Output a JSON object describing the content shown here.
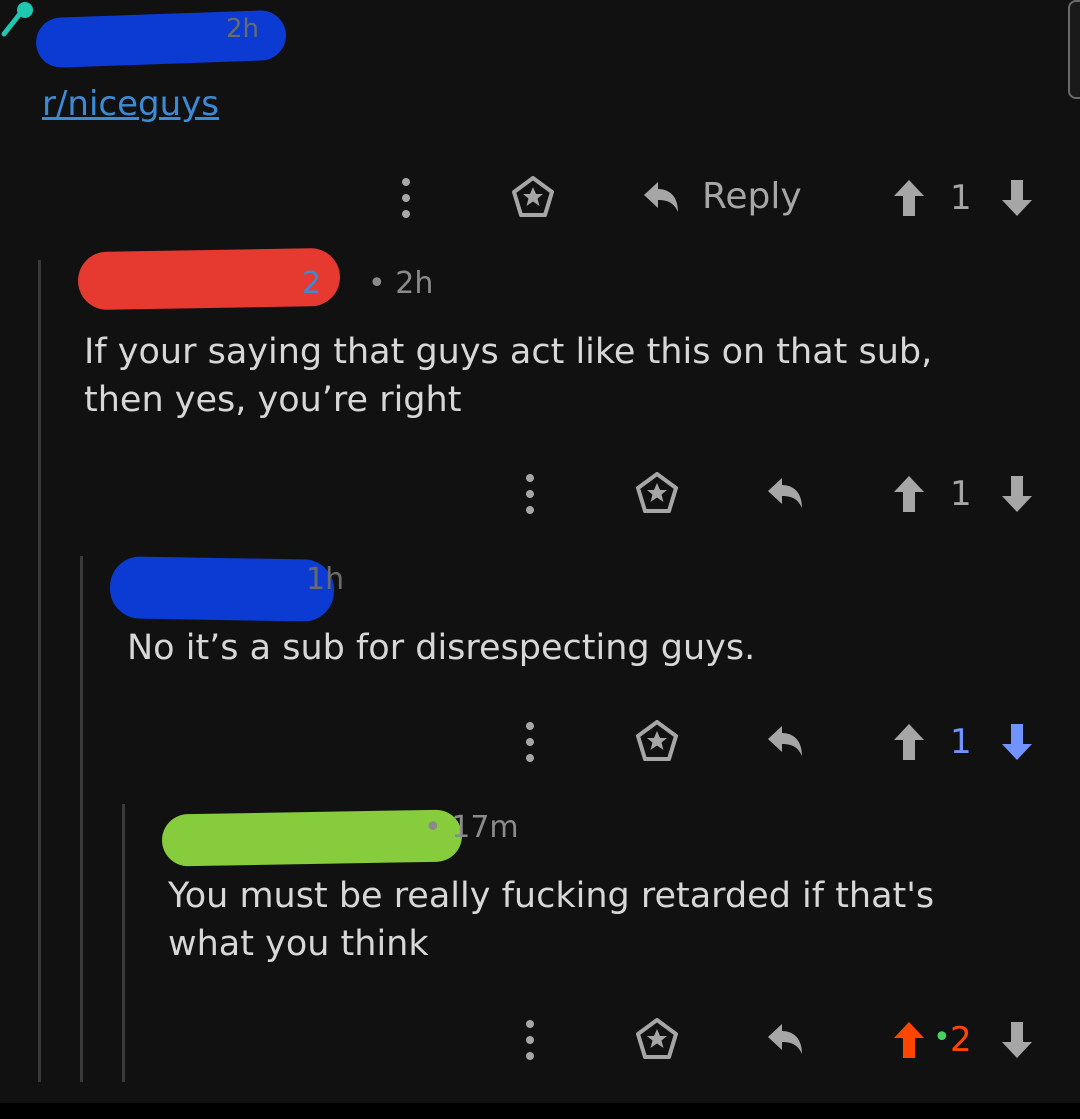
{
  "top_comment": {
    "age": "2h",
    "body": "r/niceguys",
    "actions": {
      "reply_label": "Reply",
      "score": "1"
    }
  },
  "comment_2": {
    "flair": "2",
    "age": "• 2h",
    "body": "If your saying that guys act like this on that sub,\nthen yes, you’re right",
    "score": "1"
  },
  "comment_3": {
    "age": "1h",
    "body": "No it’s a sub for disrespecting guys.",
    "score": "1"
  },
  "comment_4": {
    "age": "• 17m",
    "body": "You must be really fucking retarded if that's\nwhat you think",
    "score": "2",
    "score_prefix": "•"
  },
  "colors": {
    "upvoted": "#ff4500",
    "downvoted": "#7193ff",
    "muted": "#a6a6a6",
    "link": "#3b8bd6",
    "online": "#46d160"
  },
  "icons": [
    "more-options-icon",
    "award-icon",
    "reply-icon",
    "upvote-icon",
    "downvote-icon",
    "microphone-icon"
  ]
}
